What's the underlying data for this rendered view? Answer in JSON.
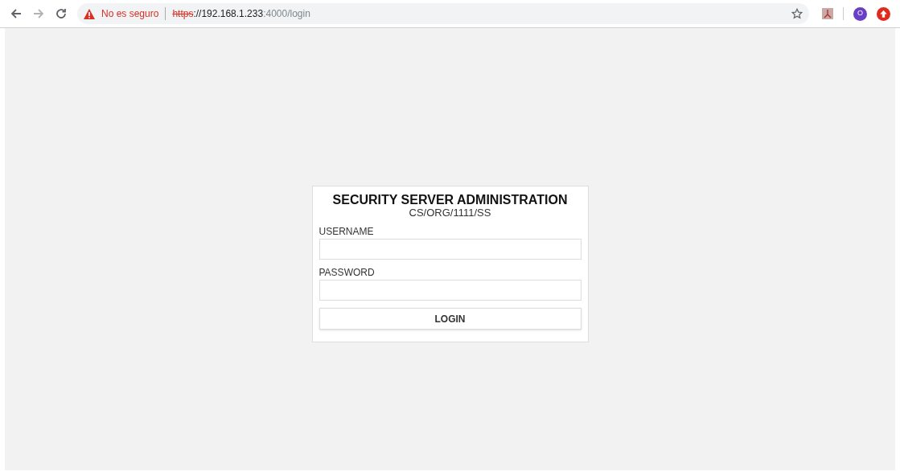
{
  "browser": {
    "security_label": "No es seguro",
    "url": [
      {
        "kind": "scheme",
        "text": "https"
      },
      {
        "kind": "host",
        "text": "://192.168.1.233"
      },
      {
        "kind": "path",
        "text": ":4000/login"
      }
    ],
    "profile_initial": "O"
  },
  "login": {
    "title": "SECURITY SERVER ADMINISTRATION",
    "subtitle": "CS/ORG/1111/SS",
    "fields": [
      {
        "label": "USERNAME"
      },
      {
        "label": "PASSWORD"
      }
    ],
    "button": "LOGIN"
  }
}
